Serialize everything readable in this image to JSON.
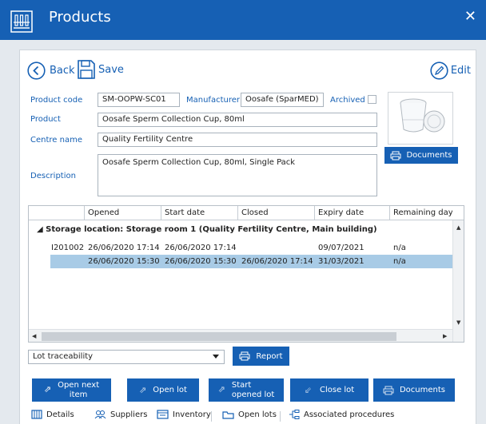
{
  "window": {
    "title": "Products",
    "close_glyph": "✕"
  },
  "toolbar": {
    "back_label": "Back",
    "save_label": "Save",
    "edit_label": "Edit"
  },
  "form": {
    "product_code_label": "Product code",
    "product_code_value": "SM-OOPW-SC01",
    "manufacturer_label": "Manufacturer",
    "manufacturer_value": "Oosafe (SparMED)",
    "archived_label": "Archived",
    "archived_checked": false,
    "product_label": "Product",
    "product_value": "Oosafe Sperm Collection Cup, 80ml",
    "centre_label": "Centre name",
    "centre_value": "Quality Fertility Centre",
    "description_label": "Description",
    "description_value": "Oosafe Sperm Collection Cup, 80ml, Single Pack",
    "documents_label": "Documents"
  },
  "grid": {
    "columns": [
      "",
      "Opened",
      "Start date",
      "Closed",
      "Expiry date",
      "Remaining day"
    ],
    "group_label": "◢ Storage location: Storage room 1 (Quality Fertility Centre, Main building)",
    "rows": [
      {
        "lot": "I201002",
        "opened": "26/06/2020 17:14",
        "start": "26/06/2020 17:14",
        "closed": "",
        "expiry": "09/07/2021",
        "remaining": "n/a",
        "selected": false
      },
      {
        "lot": "",
        "opened": "26/06/2020 15:30",
        "start": "26/06/2020 15:30",
        "closed": "26/06/2020 17:14",
        "expiry": "31/03/2021",
        "remaining": "n/a",
        "selected": true
      }
    ]
  },
  "report": {
    "select_value": "Lot traceability",
    "report_label": "Report"
  },
  "actions": {
    "open_next_line1": "Open next",
    "open_next_line2": "item",
    "open_lot": "Open lot",
    "start_opened_line1": "Start",
    "start_opened_line2": "opened lot",
    "close_lot": "Close lot",
    "documents": "Documents"
  },
  "tabs": {
    "details": "Details",
    "suppliers": "Suppliers",
    "inventory": "Inventory",
    "open_lots": "Open lots",
    "associated": "Associated procedures"
  },
  "colors": {
    "primary": "#1660b4",
    "selection": "#a8cbe6",
    "background": "#e4e9ee"
  }
}
